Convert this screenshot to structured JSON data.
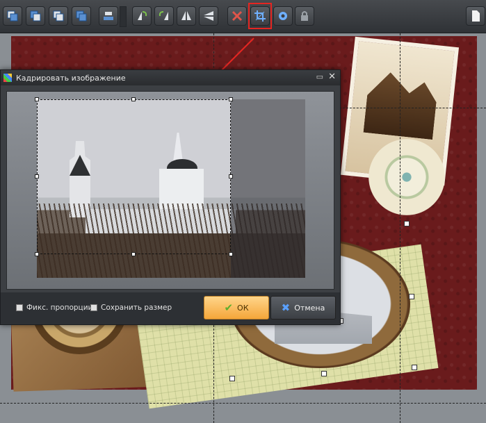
{
  "toolbar": {
    "buttons": [
      {
        "name": "bring-to-front-icon"
      },
      {
        "name": "bring-forward-icon"
      },
      {
        "name": "send-backward-icon"
      },
      {
        "name": "send-to-back-icon"
      },
      {
        "name": "align-icon"
      },
      {
        "name": "rotate-left-icon"
      },
      {
        "name": "rotate-right-icon"
      },
      {
        "name": "flip-horizontal-icon"
      },
      {
        "name": "flip-vertical-icon"
      },
      {
        "name": "delete-icon"
      },
      {
        "name": "crop-icon"
      },
      {
        "name": "settings-icon"
      },
      {
        "name": "lock-icon"
      },
      {
        "name": "page-icon"
      }
    ],
    "highlight_color": "#e52521"
  },
  "dialog": {
    "title": "Кадрировать изображение",
    "minimize_glyph": "▭",
    "close_glyph": "✕",
    "checkbox_proportions": "Фикс. пропорции",
    "checkbox_keep_size": "Сохранить размер",
    "ok_label": "ОК",
    "cancel_label": "Отмена",
    "ok_icon": "✔",
    "cancel_icon": "✖"
  },
  "colors": {
    "accent_ok": "#f4a63a",
    "arrow": "#e52521",
    "workspace_bg": "#6a1b1c"
  }
}
